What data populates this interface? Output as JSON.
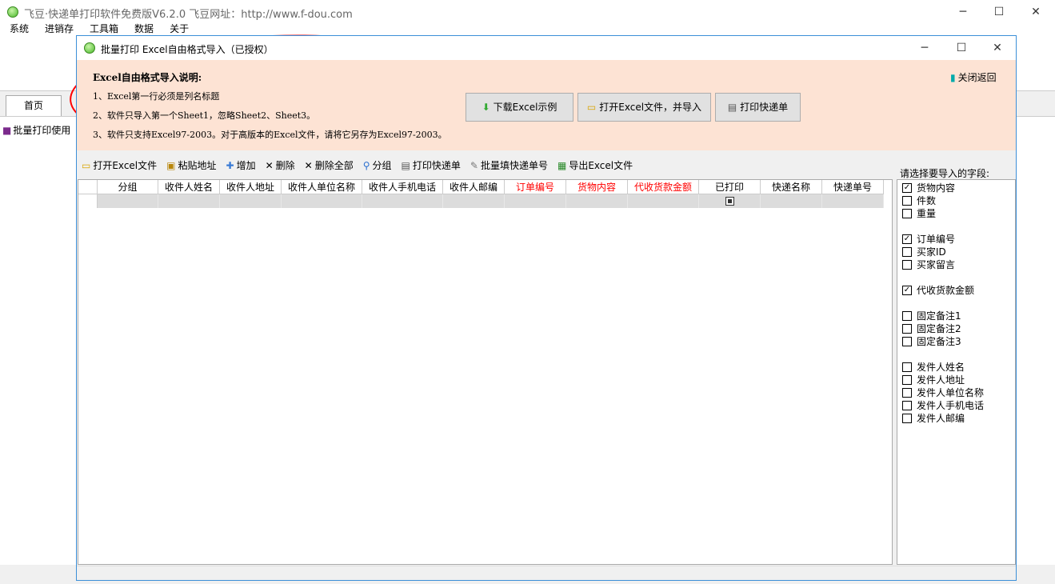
{
  "app": {
    "title": "飞豆·快递单打印软件免费版V6.2.0  飞豆网址：http://www.f-dou.com",
    "menu": [
      "系统",
      "进销存",
      "工具箱",
      "数据",
      "关于"
    ],
    "tab_home": "首页",
    "side_item": "批量打印使用"
  },
  "dialog": {
    "title": "批量打印   Excel自由格式导入（已授权）",
    "close_return": "关闭返回",
    "info_title": "Excel自由格式导入说明:",
    "info_lines": [
      "1、Excel第一行必须是列名标题",
      "2、软件只导入第一个Sheet1，忽略Sheet2、Sheet3。",
      "3、软件只支持Excel97-2003。对于高版本的Excel文件，请将它另存为Excel97-2003。"
    ],
    "buttons": {
      "download": "下载Excel示例",
      "open_import": "打开Excel文件，并导入",
      "print": "打印快递单"
    },
    "toolbar": [
      "打开Excel文件",
      "粘贴地址",
      "增加",
      "删除",
      "删除全部",
      "分组",
      "打印快递单",
      "批量填快递单号",
      "导出Excel文件"
    ],
    "columns": [
      {
        "label": "分组",
        "red": false
      },
      {
        "label": "收件人姓名",
        "red": false
      },
      {
        "label": "收件人地址",
        "red": false
      },
      {
        "label": "收件人单位名称",
        "red": false
      },
      {
        "label": "收件人手机电话",
        "red": false
      },
      {
        "label": "收件人邮编",
        "red": false
      },
      {
        "label": "订单编号",
        "red": true
      },
      {
        "label": "货物内容",
        "red": true
      },
      {
        "label": "代收货款金额",
        "red": true
      },
      {
        "label": "已打印",
        "red": false
      },
      {
        "label": "快递名称",
        "red": false
      },
      {
        "label": "快递单号",
        "red": false
      }
    ],
    "fields_label": "请选择要导入的字段:",
    "fields": [
      {
        "label": "货物内容",
        "checked": true
      },
      {
        "label": "件数",
        "checked": false
      },
      {
        "label": "重量",
        "checked": false
      },
      {
        "label": "订单编号",
        "checked": true
      },
      {
        "label": "买家ID",
        "checked": false
      },
      {
        "label": "买家留言",
        "checked": false
      },
      {
        "label": "代收货款金额",
        "checked": true
      },
      {
        "label": "固定备注1",
        "checked": false
      },
      {
        "label": "固定备注2",
        "checked": false
      },
      {
        "label": "固定备注3",
        "checked": false
      },
      {
        "label": "发件人姓名",
        "checked": false
      },
      {
        "label": "发件人地址",
        "checked": false
      },
      {
        "label": "发件人单位名称",
        "checked": false
      },
      {
        "label": "发件人手机电话",
        "checked": false
      },
      {
        "label": "发件人邮编",
        "checked": false
      }
    ]
  },
  "colors": {
    "info_bg": "#fde3d4",
    "annotation": "#ff0000",
    "dialog_border": "#3c8fd8"
  }
}
